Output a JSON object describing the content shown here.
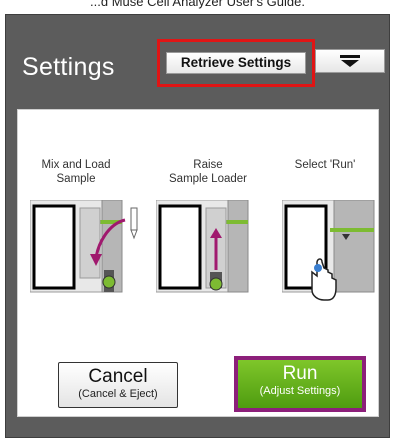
{
  "caption": "...d Muse Cell Analyzer User's Guide.",
  "header": {
    "title": "Settings",
    "retrieve_label": "Retrieve Settings"
  },
  "steps": [
    {
      "line1": "Mix and Load",
      "line2": "Sample"
    },
    {
      "line1": "Raise",
      "line2": "Sample Loader"
    },
    {
      "line1": "Select 'Run'",
      "line2": ""
    }
  ],
  "cancel": {
    "label": "Cancel",
    "sub": "(Cancel & Eject)"
  },
  "run": {
    "label": "Run",
    "sub": "(Adjust Settings)"
  },
  "colors": {
    "frame": "#5c5c5c",
    "highlight": "#e01515",
    "run_green": "#5fae18",
    "run_border": "#8c1f7a",
    "accent_green": "#7dbb32",
    "arrow_magenta": "#a0196e"
  },
  "icons": [
    "chevron-down-icon",
    "pipette-icon",
    "curved-arrow-icon",
    "up-arrow-icon",
    "hand-pointer-icon"
  ]
}
